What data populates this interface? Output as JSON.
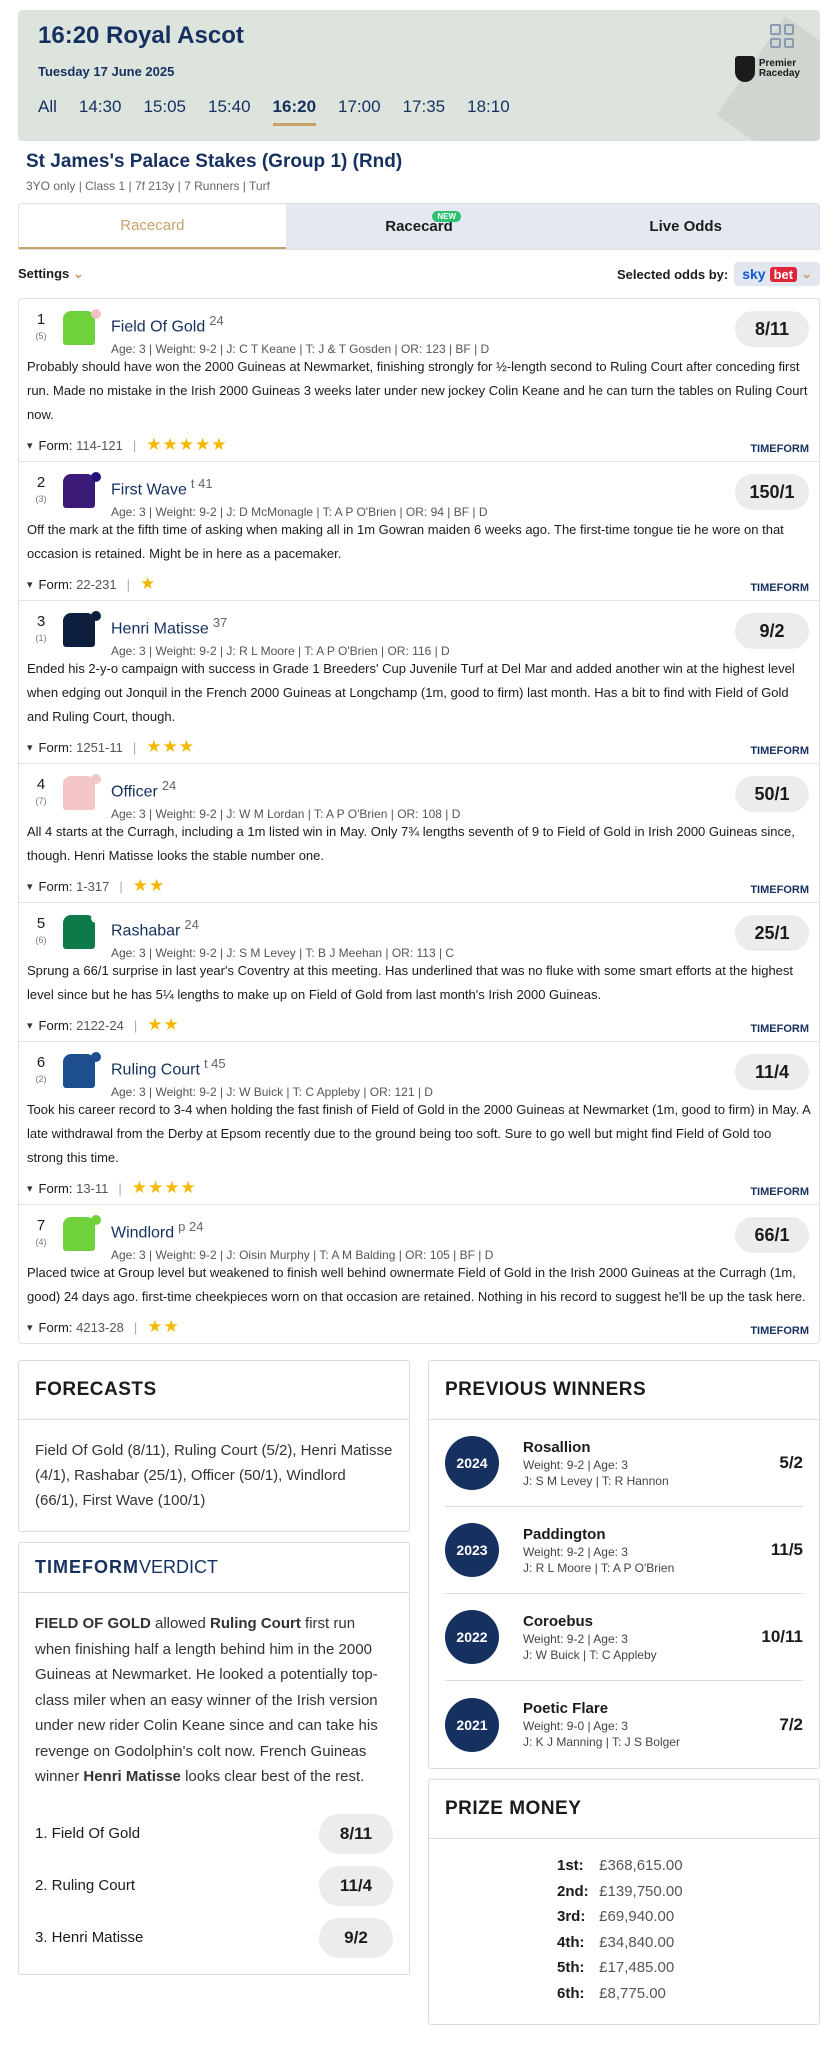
{
  "header": {
    "title": "16:20 Royal Ascot",
    "date": "Tuesday 17 June 2025",
    "times": [
      "All",
      "14:30",
      "15:05",
      "15:40",
      "16:20",
      "17:00",
      "17:35",
      "18:10"
    ],
    "active_time": "16:20",
    "logo_line1": "Premier",
    "logo_line2": "Raceday"
  },
  "race": {
    "name": "St James's Palace Stakes (Group 1) (Rnd)",
    "meta": "3YO only  |   Class 1  |   7f 213y  |   7 Runners  |   Turf"
  },
  "tabs": {
    "t1": "Racecard",
    "t2": "Racecard",
    "t2_badge": "NEW",
    "t3": "Live Odds"
  },
  "bar": {
    "settings": "Settings",
    "selected": "Selected odds by:",
    "sky": "sky",
    "bet": "bet"
  },
  "runners": [
    {
      "num": "1",
      "draw": "(5)",
      "name": "Field Of Gold",
      "sup": "24",
      "det": "Age: 3  |  Weight: 9-2 | J: C T Keane | T: J & T Gosden | OR:  123 | BF | D",
      "price": "8/11",
      "comment": "Probably should have won the 2000 Guineas at Newmarket, finishing strongly for ½-length second to Ruling Court after conceding first run. Made no mistake in the Irish 2000 Guineas 3 weeks later under new jockey Colin Keane and he can turn the tables on Ruling Court now.",
      "form": "114-121",
      "stars": "★★★★★",
      "body": "#6fd23a",
      "cap": "#f2c2c2"
    },
    {
      "num": "2",
      "draw": "(3)",
      "name": "First Wave",
      "sup": "t 41",
      "det": "Age: 3  |  Weight: 9-2 | J: D McMonagle | T: A P O'Brien | OR:  94 | BF | D",
      "price": "150/1",
      "comment": "Off the mark at the fifth time of asking when making all in 1m Gowran maiden 6 weeks ago. The first-time tongue tie he wore on that occasion is retained. Might be in here as a pacemaker.",
      "form": "22-231",
      "stars": "★",
      "body": "#3b1a78",
      "cap": "#24117a"
    },
    {
      "num": "3",
      "draw": "(1)",
      "name": "Henri Matisse",
      "sup": "37",
      "det": "Age: 3  |  Weight: 9-2 | J: R L Moore | T: A P O'Brien | OR:  116 | D",
      "price": "9/2",
      "comment": "Ended his 2-y-o campaign with success in Grade 1 Breeders' Cup Juvenile Turf at Del Mar and added another win at the highest level when edging out Jonquil in the French 2000 Guineas at Longchamp (1m, good to firm) last month. Has a bit to find with Field of Gold and Ruling Court, though.",
      "form": "1251-11",
      "stars": "★★★",
      "body": "#0d1f3c",
      "cap": "#0d1f3c"
    },
    {
      "num": "4",
      "draw": "(7)",
      "name": "Officer",
      "sup": "24",
      "det": "Age: 3  |  Weight: 9-2 | J: W M Lordan | T: A P O'Brien | OR:  108 | D",
      "price": "50/1",
      "comment": "All 4 starts at the Curragh, including a 1m listed win in May. Only 7¾ lengths seventh of 9 to Field of Gold in Irish 2000 Guineas since, though. Henri Matisse looks the stable number one.",
      "form": "1-317",
      "stars": "★★",
      "body": "#f5c6c6",
      "cap": "#f5c6c6"
    },
    {
      "num": "5",
      "draw": "(6)",
      "name": "Rashabar",
      "sup": "24",
      "det": "Age: 3  |  Weight: 9-2 | J: S M Levey | T: B J Meehan | OR:  113 | C",
      "price": "25/1",
      "comment": "Sprung a 66/1 surprise in last year's Coventry at this meeting. Has underlined that was no fluke with some smart efforts at the highest level since but he has 5¼ lengths to make up on Field of Gold from last month's Irish 2000 Guineas.",
      "form": "2122-24",
      "stars": "★★",
      "body": "#0e7a4a",
      "cap": "#ffffff"
    },
    {
      "num": "6",
      "draw": "(2)",
      "name": "Ruling Court",
      "sup": "t 45",
      "det": "Age: 3  |  Weight: 9-2 | J: W Buick | T: C Appleby | OR:  121 | D",
      "price": "11/4",
      "comment": "Took his career record to 3-4 when holding the fast finish of Field of Gold in the 2000 Guineas at Newmarket (1m, good to firm) in May. A late withdrawal from the Derby at Epsom recently due to the ground being too soft. Sure to go well but might find Field of Gold too strong this time.",
      "form": "13-11",
      "stars": "★★★★",
      "body": "#1d4e8f",
      "cap": "#1d4e8f"
    },
    {
      "num": "7",
      "draw": "(4)",
      "name": "Windlord",
      "sup": "p 24",
      "det": "Age: 3  |  Weight: 9-2 | J: Oisin Murphy | T: A M Balding | OR:  105 | BF | D",
      "price": "66/1",
      "comment": "Placed twice at Group level but weakened to finish well behind ownermate Field of Gold in the Irish 2000 Guineas at the Curragh (1m, good) 24 days ago. first-time cheekpieces worn on that occasion are retained. Nothing in his record to suggest he'll be up the task here.",
      "form": "4213-28",
      "stars": "★★",
      "body": "#6fd23a",
      "cap": "#6fd23a"
    }
  ],
  "form_label": "Form:",
  "timeform": "TIMEFORM",
  "forecasts": {
    "title": "FORECASTS",
    "text": "Field Of Gold (8/11), Ruling Court (5/2), Henri Matisse (4/1), Rashabar (25/1), Officer (50/1), Windlord (66/1), First Wave (100/1)"
  },
  "verdict": {
    "brand": "TIMEFORM",
    "label": "VERDICT",
    "lead": "FIELD OF GOLD",
    "t1": " allowed ",
    "rc": "Ruling Court",
    "t2": " first run when finishing half a length behind him in the 2000 Guineas at Newmarket. He looked a potentially top-class miler when an easy winner of the Irish version under new rider Colin Keane since and can take his revenge on Godolphin's colt now. French Guineas winner ",
    "hm": "Henri Matisse",
    "t3": " looks clear best of the rest.",
    "picks": [
      {
        "l": "1. Field Of Gold",
        "p": "8/11"
      },
      {
        "l": "2. Ruling Court",
        "p": "11/4"
      },
      {
        "l": "3. Henri Matisse",
        "p": "9/2"
      }
    ]
  },
  "previous": {
    "title": "PREVIOUS WINNERS",
    "items": [
      {
        "yr": "2024",
        "n": "Rosallion",
        "w": "Weight: 9-2  |  Age: 3",
        "j": "J: S M Levey  |  T: R Hannon",
        "p": "5/2"
      },
      {
        "yr": "2023",
        "n": "Paddington",
        "w": "Weight: 9-2  |  Age: 3",
        "j": "J: R L Moore  |  T: A P O'Brien",
        "p": "11/5"
      },
      {
        "yr": "2022",
        "n": "Coroebus",
        "w": "Weight: 9-2  |  Age: 3",
        "j": "J: W Buick  |  T: C Appleby",
        "p": "10/11"
      },
      {
        "yr": "2021",
        "n": "Poetic Flare",
        "w": "Weight: 9-0  |  Age: 3",
        "j": "J: K J Manning  |  T: J S Bolger",
        "p": "7/2"
      }
    ]
  },
  "prize": {
    "title": "PRIZE MONEY",
    "items": [
      {
        "k": "1st:",
        "v": "£368,615.00"
      },
      {
        "k": "2nd:",
        "v": "£139,750.00"
      },
      {
        "k": "3rd:",
        "v": "£69,940.00"
      },
      {
        "k": "4th:",
        "v": "£34,840.00"
      },
      {
        "k": "5th:",
        "v": "£17,485.00"
      },
      {
        "k": "6th:",
        "v": "£8,775.00"
      }
    ]
  }
}
